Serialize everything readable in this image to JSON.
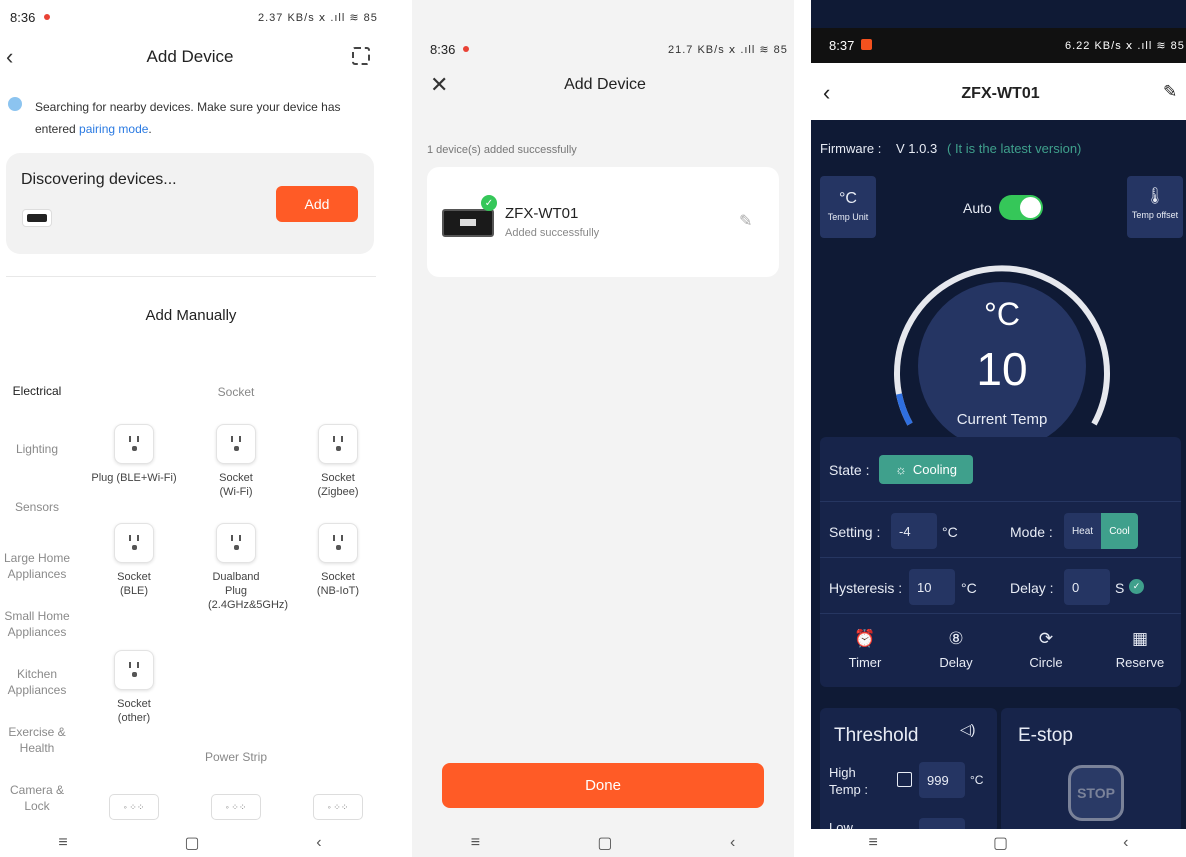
{
  "screen1": {
    "status_time": "8:36",
    "status_icons": "2.37 KB/s ⅹ .ıll ≋ 85",
    "title": "Add Device",
    "search_text": "Searching for nearby devices. Make sure your device has",
    "search_text2": "entered ",
    "pairing_link": "pairing mode",
    "search_period": ".",
    "discover_label": "Discovering devices...",
    "add_label": "Add",
    "manual_title": "Add Manually",
    "categories": [
      "Electrical",
      "Lighting",
      "Sensors",
      "Large Home Appliances",
      "Small Home Appliances",
      "Kitchen Appliances",
      "Exercise & Health",
      "Camera & Lock"
    ],
    "section_socket": "Socket",
    "section_strip": "Power Strip",
    "devices": [
      {
        "label": "Plug (BLE+Wi-Fi)"
      },
      {
        "label": "Socket (Wi-Fi)"
      },
      {
        "label": "Socket (Zigbee)"
      },
      {
        "label": "Socket (BLE)"
      },
      {
        "label": "Dualband Plug (2.4GHz&5GHz)"
      },
      {
        "label": "Socket (NB-IoT)"
      },
      {
        "label": "Socket (other)"
      }
    ]
  },
  "screen2": {
    "status_time": "8:36",
    "status_icons": "21.7 KB/s ⅹ .ıll ≋ 85",
    "title": "Add Device",
    "added_count": "1 device(s) added successfully",
    "device_name": "ZFX-WT01",
    "device_status": "Added successfully",
    "done_label": "Done"
  },
  "screen3": {
    "status_time": "8:37",
    "status_icons": "6.22 KB/s ⅹ .ıll ≋ 85",
    "title": "ZFX-WT01",
    "firmware_label": "Firmware :",
    "firmware_version": "V 1.0.3",
    "firmware_note": "( It is the latest version)",
    "temp_unit_symbol": "°C",
    "temp_unit_label": "Temp Unit",
    "auto_label": "Auto",
    "temp_offset_label": "Temp offset",
    "gauge_unit": "°C",
    "gauge_value": "10",
    "gauge_label": "Current Temp",
    "state_label": "State :",
    "state_value": "Cooling",
    "setting_label": "Setting :",
    "setting_value": "-4",
    "setting_unit": "°C",
    "mode_label": "Mode :",
    "mode_heat": "Heat",
    "mode_cool": "Cool",
    "hysteresis_label": "Hysteresis :",
    "hysteresis_value": "10",
    "hysteresis_unit": "°C",
    "delay_label": "Delay :",
    "delay_value": "0",
    "delay_unit": "S",
    "actions": [
      "Timer",
      "Delay",
      "Circle",
      "Reserve"
    ],
    "threshold_title": "Threshold",
    "estop_title": "E-stop",
    "high_temp_label": "High Temp :",
    "high_temp_value": "999",
    "high_temp_unit": "°C",
    "low_label": "Low",
    "stop_sign": "STOP"
  },
  "colors": {
    "accent": "#ff5b26",
    "link": "#2a7ae2",
    "dark_bg": "#0f1a35",
    "panel": "#17244a",
    "teal": "#3fa08c",
    "toggle": "#35c759"
  }
}
